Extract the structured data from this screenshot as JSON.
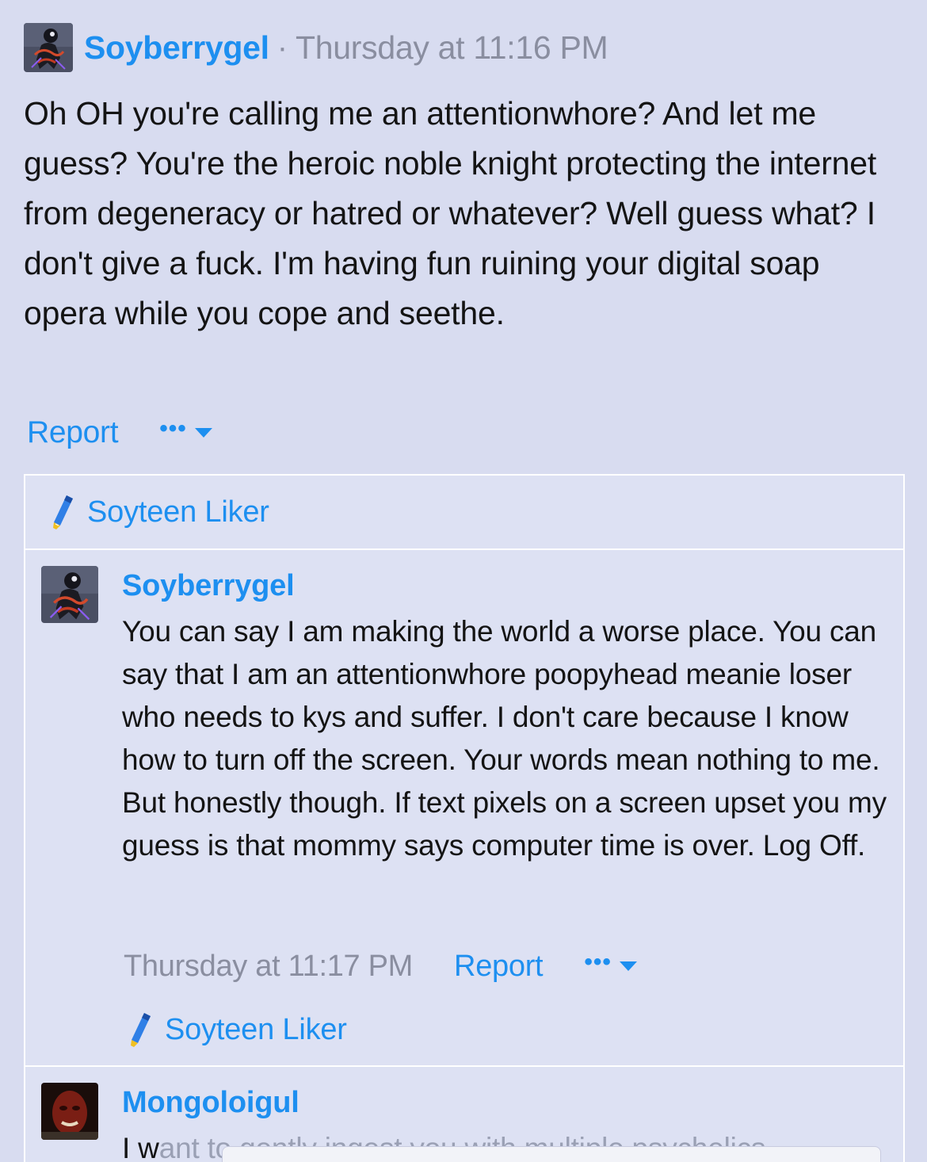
{
  "post": {
    "author": "Soyberrygel",
    "separator": "·",
    "timestamp": "Thursday at 11:16 PM",
    "body": "Oh OH you're calling me an attentionwhore? And let me guess? You're the heroic noble knight protecting the internet from degeneracy or hatred or whatever? Well guess what? I don't give a fuck. I'm having fun ruining your digital soap opera while you cope and seethe.",
    "report_label": "Report",
    "more_label": "•••",
    "likes_label": "Soyteen Liker"
  },
  "replies": [
    {
      "author": "Soyberrygel",
      "body": "You can say I am making the world a worse place. You can say that I am an attentionwhore poopyhead meanie loser who needs to kys and suffer. I don't care because I know how to turn off the screen. Your words mean nothing to me. But honestly though. If text pixels on a screen upset you my guess is that mommy says computer time is over. Log Off.",
      "timestamp": "Thursday at 11:17 PM",
      "report_label": "Report",
      "more_label": "•••",
      "likes_label": "Soyteen Liker"
    },
    {
      "author": "Mongoloigul",
      "body_visible": "I w",
      "body_faded": "ant to gently ingest you with multiple psychelics"
    }
  ],
  "colors": {
    "background": "#d8dcf0",
    "link": "#1d8ff0",
    "meta": "#8a8ea0",
    "text": "#141414"
  },
  "icons": {
    "like": "pencil-icon",
    "more": "dots-icon",
    "caret": "caret-down-icon"
  }
}
